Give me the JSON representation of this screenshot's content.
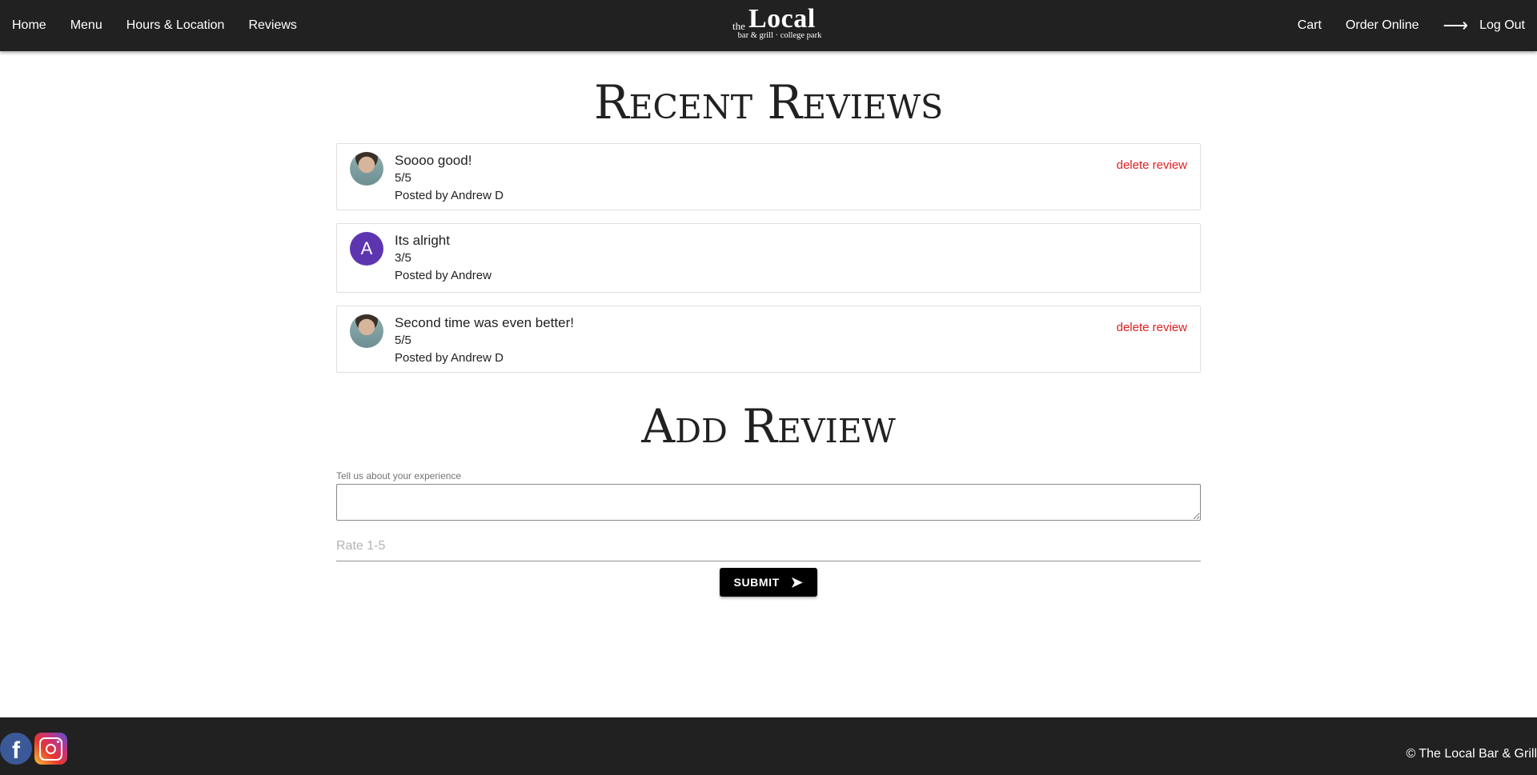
{
  "nav": {
    "left_items": [
      "Home",
      "Menu",
      "Hours & Location",
      "Reviews"
    ],
    "right_items": [
      "Cart",
      "Order Online"
    ],
    "logout_label": "Log Out",
    "logout_icon": "arrow-right-icon"
  },
  "logo": {
    "the": "the",
    "main": "Local",
    "sub": "bar & grill · college park"
  },
  "recent_reviews": {
    "heading": "Recent Reviews",
    "items": [
      {
        "title": "Soooo good!",
        "rating": "5/5",
        "posted_by": "Posted by Andrew D",
        "avatar": "photo",
        "delete_label": "delete review"
      },
      {
        "title": "Its alright",
        "rating": "3/5",
        "posted_by": "Posted by Andrew",
        "avatar": "A",
        "delete_label": ""
      },
      {
        "title": "Second time was even better!",
        "rating": "5/5",
        "posted_by": "Posted by Andrew D",
        "avatar": "photo",
        "delete_label": "delete review"
      }
    ]
  },
  "add_review": {
    "heading": "Add Review",
    "textarea_label": "Tell us about your experience",
    "textarea_value": "",
    "rate_placeholder": "Rate 1-5",
    "rate_value": "",
    "submit_label": "SUBMIT",
    "submit_icon": "send-icon"
  },
  "footer": {
    "facebook_icon": "facebook-icon",
    "instagram_icon": "instagram-icon",
    "copyright": "© The Local Bar & Grill"
  },
  "colors": {
    "navbar_bg": "#212121",
    "delete_link": "#e01e1e",
    "letter_avatar": "#5e35b1",
    "submit_bg": "#000000"
  }
}
